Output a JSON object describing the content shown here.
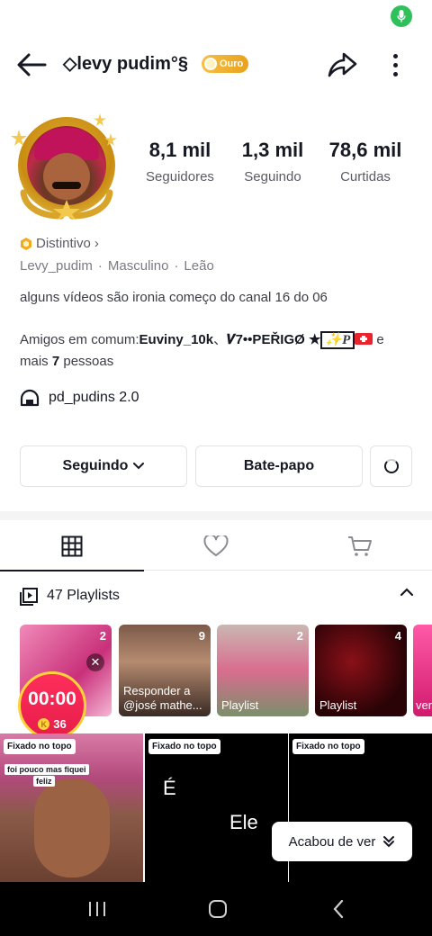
{
  "status_bar": {
    "mic_icon": "mic-icon"
  },
  "header": {
    "username": "◇levy pudim°§",
    "badge": "Ouro"
  },
  "stats": [
    {
      "value": "8,1 mil",
      "label": "Seguidores"
    },
    {
      "value": "1,3 mil",
      "label": "Seguindo"
    },
    {
      "value": "78,6 mil",
      "label": "Curtidas"
    }
  ],
  "profile": {
    "distintivo": "Distintivo",
    "handle": "Levy_pudim",
    "gender": "Masculino",
    "sign": "Leão",
    "bio": "alguns vídeos são ironia começo do canal 16 do 06",
    "friends_prefix": "Amigos em comum:",
    "friend_1": "Euviny_10k",
    "friend_sep": "、",
    "friend_2": "𝑽7••PEŘIGØ ★",
    "friend_box": "✨P",
    "friends_mid": " e mais ",
    "friends_count": "7",
    "friends_suffix": " pessoas",
    "group": "pd_pudins 2.0"
  },
  "buttons": {
    "following": "Seguindo",
    "chat": "Bate-papo"
  },
  "tabs": [
    "videos-grid",
    "liked",
    "shop"
  ],
  "playlists": {
    "title": "47 Playlists",
    "items": [
      {
        "count": "2",
        "label": ""
      },
      {
        "count": "9",
        "label": "Responder a @josé mathe..."
      },
      {
        "count": "2",
        "label": "Playlist"
      },
      {
        "count": "4",
        "label": "Playlist"
      },
      {
        "count": "",
        "label": "ver"
      }
    ]
  },
  "live": {
    "time": "00:00",
    "coins": "36",
    "coin_letter": "K"
  },
  "videos": [
    {
      "pin": "Fixado no topo",
      "caption": "foi pouco mas fiquei",
      "caption2": "feliz"
    },
    {
      "pin": "Fixado no topo",
      "text_1": "É",
      "text_2": "Ele"
    },
    {
      "pin": "Fixado no topo"
    }
  ],
  "toast": {
    "label": "Acabou de ver"
  },
  "colors": {
    "accent_gold": "#e9a21a",
    "live_red": "#ff2e5b",
    "text_primary": "#161823"
  }
}
